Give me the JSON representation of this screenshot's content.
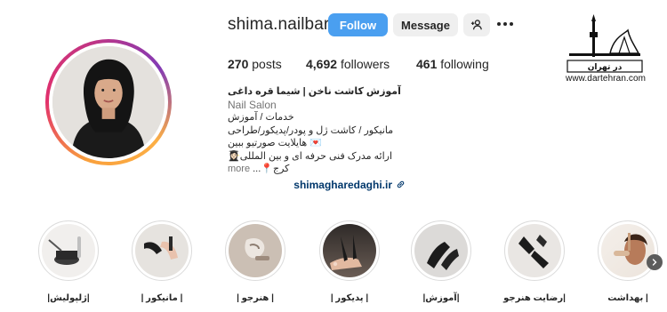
{
  "profile": {
    "username": "shima.nailbarr",
    "follow_label": "Follow",
    "message_label": "Message",
    "stats": {
      "posts_count": "270",
      "posts_label": "posts",
      "followers_count": "4,692",
      "followers_label": "followers",
      "following_count": "461",
      "following_label": "following"
    },
    "bio": {
      "name": "آموزش کاشت ناخن | شیما قره داغی",
      "category": "Nail Salon",
      "line1": "خدمات / آموزش",
      "line2": "مانیکور / کاشت ژل و پودر/پدیکور/طراحی",
      "line3": "💌 هایلایت صورتیو ببین",
      "line4": "ارائه مدرک فنی حرفه ای و بین المللی👩🏻‍🎓",
      "line5": "کرج📍...",
      "more_label": "more",
      "link": "shimagharedaghi.ir"
    }
  },
  "watermark": {
    "url": "www.dartehran.com"
  },
  "highlights": [
    {
      "label": "| بهداشت"
    },
    {
      "label": "|رضایت هنرجو"
    },
    {
      "label": "|آموزش|"
    },
    {
      "label": "| پدیکور |"
    },
    {
      "label": "| هنرجو |"
    },
    {
      "label": "| مانیکور |"
    },
    {
      "label": "|ژلپولیش|"
    }
  ],
  "colors": {
    "follow_button": "#4a9ff0",
    "secondary_button": "#efefef",
    "link": "#00376b",
    "text": "#262626",
    "muted": "#737373"
  }
}
